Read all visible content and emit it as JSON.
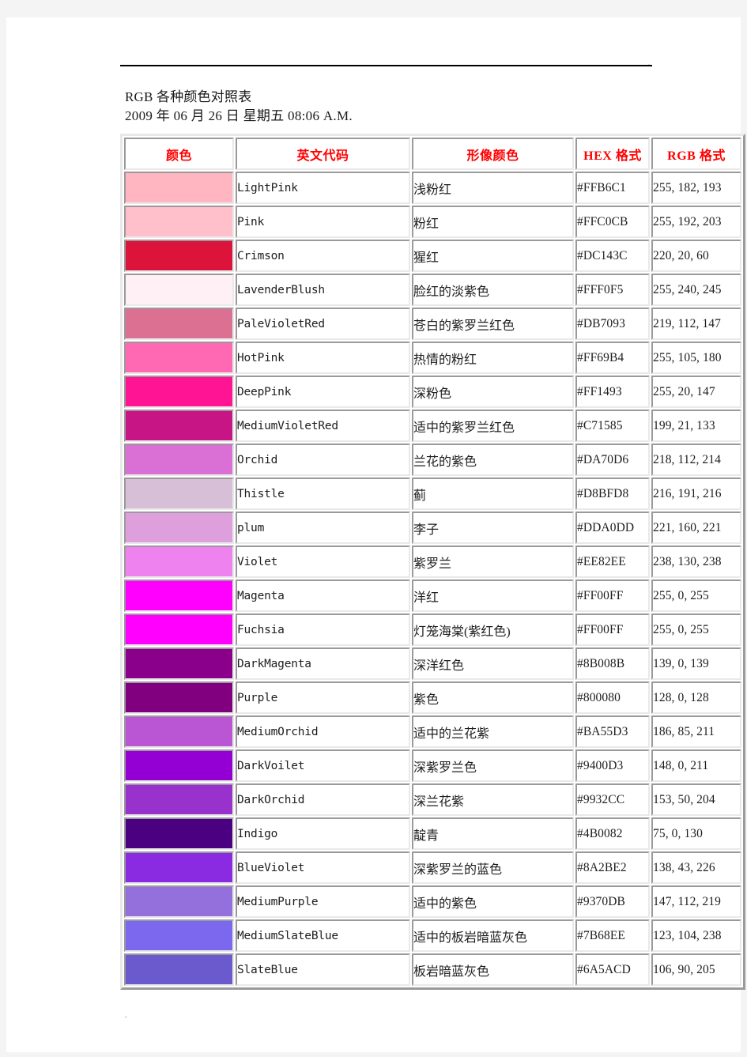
{
  "document": {
    "title": "RGB 各种颜色对照表",
    "datetime": "2009 年 06 月 26 日  星期五  08:06 A.M.",
    "rule_tick": ".",
    "footer_mark": "."
  },
  "table": {
    "headers": {
      "swatch": "颜色",
      "name": "英文代码",
      "chinese": "形像颜色",
      "hex": "HEX 格式",
      "rgb": "RGB 格式"
    },
    "header_color": "#FF0000",
    "rows": [
      {
        "swatch": "#FFB6C1",
        "name": "LightPink",
        "chinese": "浅粉红",
        "hex": "#FFB6C1",
        "rgb": "255, 182, 193"
      },
      {
        "swatch": "#FFC0CB",
        "name": "Pink",
        "chinese": "粉红",
        "hex": "#FFC0CB",
        "rgb": "255, 192, 203"
      },
      {
        "swatch": "#DC143C",
        "name": "Crimson",
        "chinese": "猩红",
        "hex": "#DC143C",
        "rgb": "220, 20, 60"
      },
      {
        "swatch": "#FFF0F5",
        "name": "LavenderBlush",
        "chinese": "脸红的淡紫色",
        "hex": "#FFF0F5",
        "rgb": "255, 240, 245"
      },
      {
        "swatch": "#DB7093",
        "name": "PaleVioletRed",
        "chinese": "苍白的紫罗兰红色",
        "hex": "#DB7093",
        "rgb": "219, 112, 147"
      },
      {
        "swatch": "#FF69B4",
        "name": "HotPink",
        "chinese": "热情的粉红",
        "hex": "#FF69B4",
        "rgb": "255, 105, 180"
      },
      {
        "swatch": "#FF1493",
        "name": "DeepPink",
        "chinese": "深粉色",
        "hex": "#FF1493",
        "rgb": "255, 20, 147"
      },
      {
        "swatch": "#C71585",
        "name": "MediumVioletRed",
        "chinese": "适中的紫罗兰红色",
        "hex": "#C71585",
        "rgb": "199, 21, 133"
      },
      {
        "swatch": "#DA70D6",
        "name": "Orchid",
        "chinese": "兰花的紫色",
        "hex": "#DA70D6",
        "rgb": "218, 112, 214"
      },
      {
        "swatch": "#D8BFD8",
        "name": "Thistle",
        "chinese": "蓟",
        "hex": "#D8BFD8",
        "rgb": "216, 191, 216"
      },
      {
        "swatch": "#DDA0DD",
        "name": "plum",
        "chinese": "李子",
        "hex": "#DDA0DD",
        "rgb": "221, 160, 221"
      },
      {
        "swatch": "#EE82EE",
        "name": "Violet",
        "chinese": "紫罗兰",
        "hex": "#EE82EE",
        "rgb": "238, 130, 238"
      },
      {
        "swatch": "#FF00FF",
        "name": "Magenta",
        "chinese": "洋红",
        "hex": "#FF00FF",
        "rgb": "255, 0, 255"
      },
      {
        "swatch": "#FF00FF",
        "name": "Fuchsia",
        "chinese": "灯笼海棠(紫红色)",
        "hex": "#FF00FF",
        "rgb": "255, 0, 255"
      },
      {
        "swatch": "#8B008B",
        "name": "DarkMagenta",
        "chinese": "深洋红色",
        "hex": "#8B008B",
        "rgb": "139, 0, 139"
      },
      {
        "swatch": "#800080",
        "name": "Purple",
        "chinese": "紫色",
        "hex": "#800080",
        "rgb": "128, 0, 128"
      },
      {
        "swatch": "#BA55D3",
        "name": "MediumOrchid",
        "chinese": "适中的兰花紫",
        "hex": "#BA55D3",
        "rgb": "186, 85, 211"
      },
      {
        "swatch": "#9400D3",
        "name": "DarkVoilet",
        "chinese": "深紫罗兰色",
        "hex": "#9400D3",
        "rgb": "148, 0, 211"
      },
      {
        "swatch": "#9932CC",
        "name": "DarkOrchid",
        "chinese": "深兰花紫",
        "hex": "#9932CC",
        "rgb": "153, 50, 204"
      },
      {
        "swatch": "#4B0082",
        "name": "Indigo",
        "chinese": "靛青",
        "hex": "#4B0082",
        "rgb": "75, 0, 130"
      },
      {
        "swatch": "#8A2BE2",
        "name": "BlueViolet",
        "chinese": "深紫罗兰的蓝色",
        "hex": "#8A2BE2",
        "rgb": "138, 43, 226"
      },
      {
        "swatch": "#9370DB",
        "name": "MediumPurple",
        "chinese": "适中的紫色",
        "hex": "#9370DB",
        "rgb": "147, 112, 219"
      },
      {
        "swatch": "#7B68EE",
        "name": "MediumSlateBlue",
        "chinese": "适中的板岩暗蓝灰色",
        "hex": "#7B68EE",
        "rgb": "123, 104, 238"
      },
      {
        "swatch": "#6A5ACD",
        "name": "SlateBlue",
        "chinese": "板岩暗蓝灰色",
        "hex": "#6A5ACD",
        "rgb": "106, 90, 205"
      }
    ]
  }
}
